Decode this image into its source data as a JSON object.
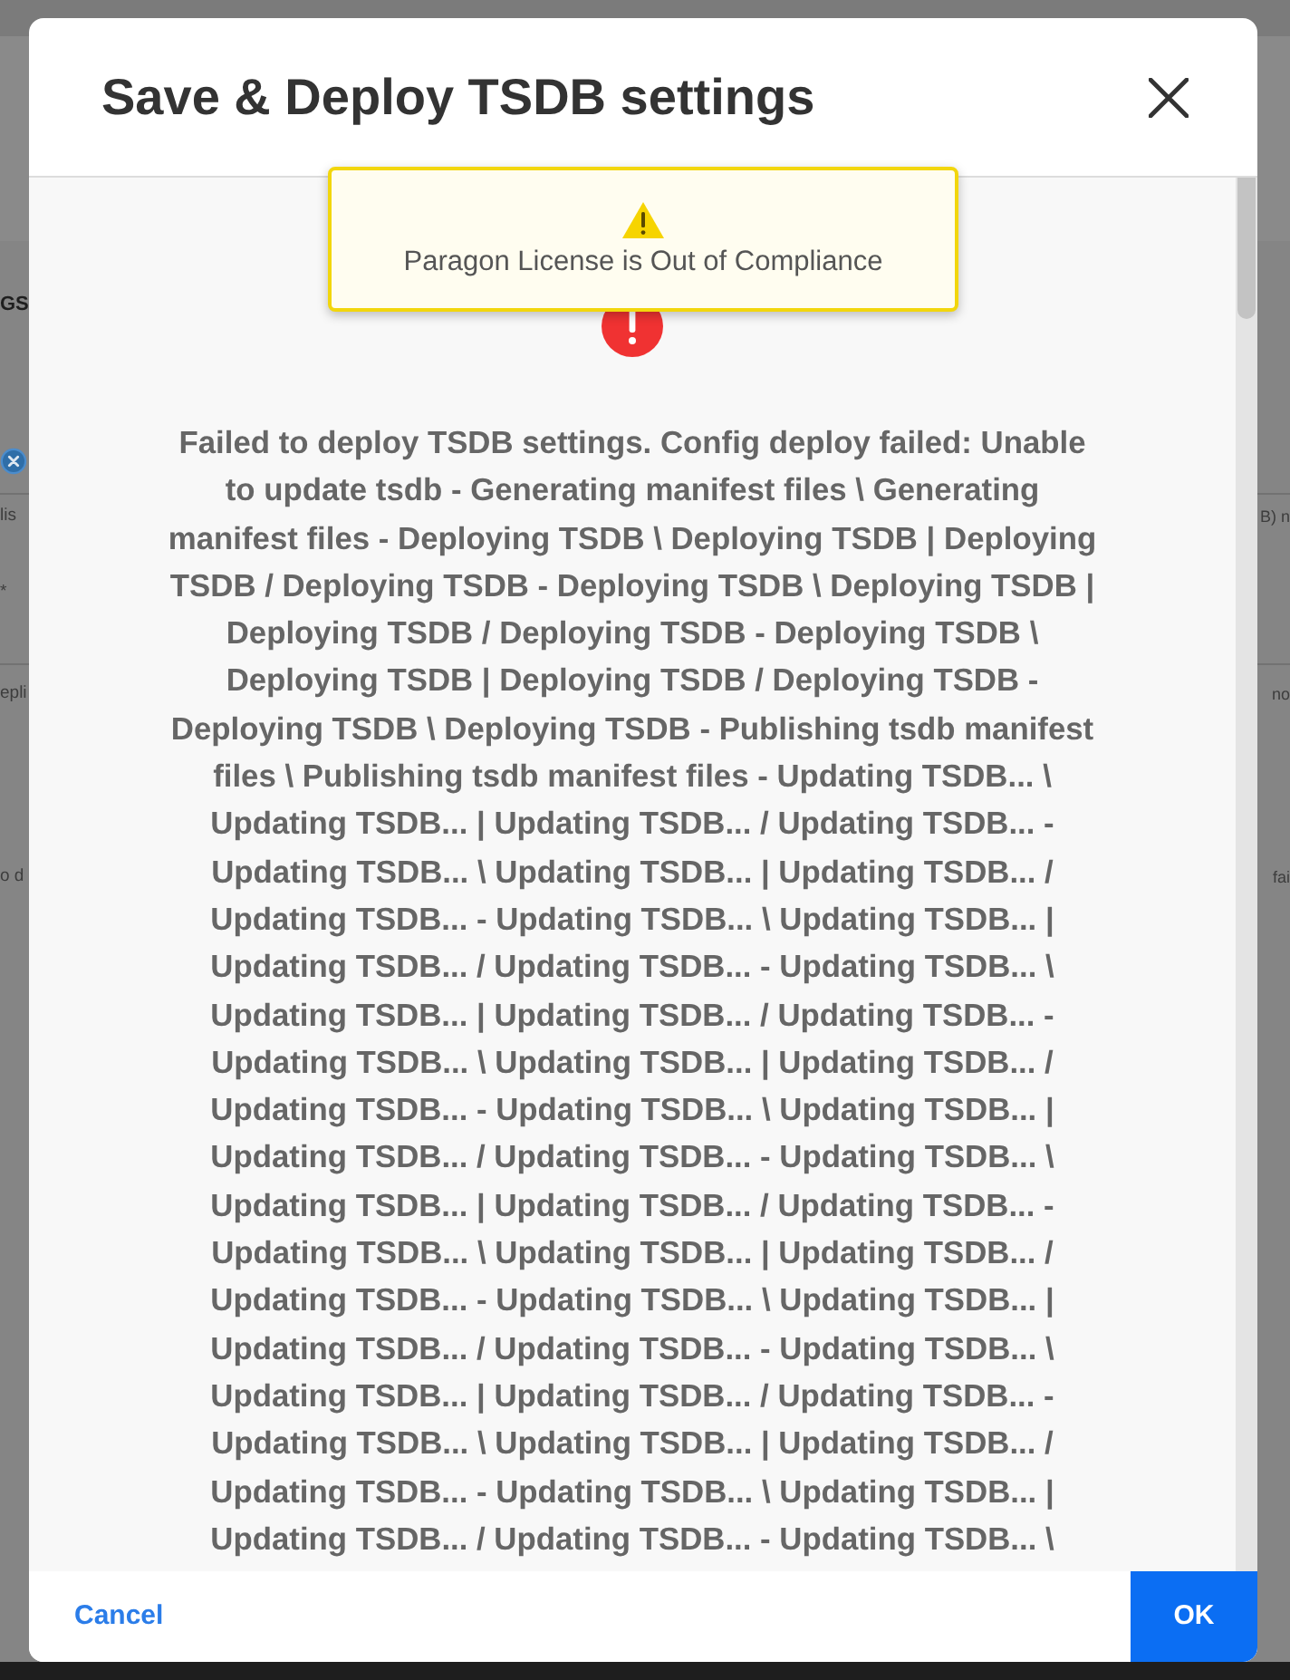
{
  "background_page": {
    "heading_fragment": "GS",
    "rows": [
      {
        "left": "lis",
        "right": "B) n"
      },
      {
        "left": "*"
      },
      {
        "left": "epli",
        "right": "no"
      },
      {
        "left": "o d",
        "right": "fai"
      }
    ]
  },
  "dialog": {
    "title": "Save & Deploy TSDB settings",
    "error_message": "Failed to deploy TSDB settings. Config deploy failed: Unable to update tsdb - Generating manifest files \\ Generating manifest files - Deploying TSDB \\ Deploying TSDB | Deploying TSDB / Deploying TSDB - Deploying TSDB \\ Deploying TSDB | Deploying TSDB / Deploying TSDB - Deploying TSDB \\ Deploying TSDB | Deploying TSDB / Deploying TSDB - Deploying TSDB \\ Deploying TSDB - Publishing tsdb manifest files \\ Publishing tsdb manifest files - Updating TSDB... \\ Updating TSDB... | Updating TSDB... / Updating TSDB... - Updating TSDB... \\ Updating TSDB... | Updating TSDB... / Updating TSDB... - Updating TSDB... \\ Updating TSDB... | Updating TSDB... / Updating TSDB... - Updating TSDB... \\ Updating TSDB... | Updating TSDB... / Updating TSDB... - Updating TSDB... \\ Updating TSDB... | Updating TSDB... / Updating TSDB... - Updating TSDB... \\ Updating TSDB... | Updating TSDB... / Updating TSDB... - Updating TSDB... \\ Updating TSDB... | Updating TSDB... / Updating TSDB... - Updating TSDB... \\ Updating TSDB... | Updating TSDB... / Updating TSDB... - Updating TSDB... \\ Updating TSDB... | Updating TSDB... / Updating TSDB... - Updating TSDB... \\ Updating TSDB... | Updating TSDB... / Updating TSDB... - Updating TSDB... \\ Updating TSDB... | Updating TSDB... / Updating TSDB... - Updating TSDB... \\ Updating TSDB... | Updating TSDB... / Updating TSDB... - Updating TSDB... \\",
    "buttons": [
      {
        "label": "Cancel",
        "kind": "link"
      },
      {
        "label": "OK",
        "kind": "primary"
      }
    ]
  },
  "toast": {
    "kind": "warning",
    "text": "Paragon License is Out of Compliance"
  }
}
